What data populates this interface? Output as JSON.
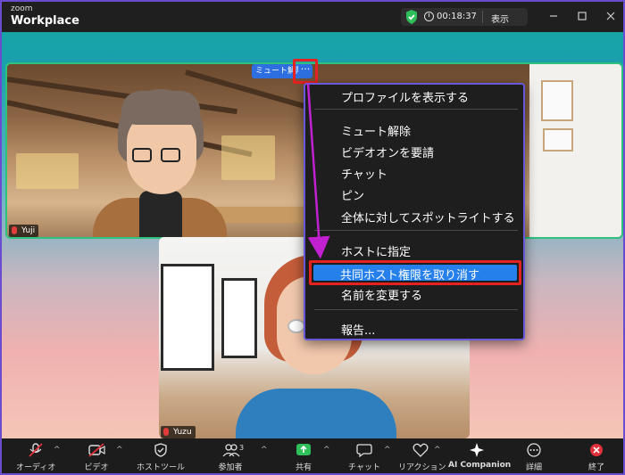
{
  "app": {
    "brand_small": "zoom",
    "brand_large": "Workplace"
  },
  "status": {
    "timer": "00:18:37",
    "view_label": "表示"
  },
  "participants": {
    "yuji": {
      "name": "Yuji",
      "unmute_chip": "ミュート解除",
      "more_glyph": "···"
    },
    "yuzu": {
      "name": "Yuzu"
    }
  },
  "context_menu": {
    "items": [
      "プロファイルを表示する",
      "ミュート解除",
      "ビデオオンを要請",
      "チャット",
      "ピン",
      "全体に対してスポットライトする",
      "ホストに指定",
      "共同ホスト権限を取り消す",
      "名前を変更する",
      "報告..."
    ]
  },
  "toolbar": {
    "audio": "オーディオ",
    "video": "ビデオ",
    "host_tools": "ホストツール",
    "participants": "参加者",
    "participants_count": "3",
    "share": "共有",
    "chat": "チャット",
    "reactions": "リアクション",
    "ai_companion": "AI Companion",
    "more": "詳細",
    "end": "終了",
    "caret": "^"
  },
  "colors": {
    "accent_blue": "#2680eb",
    "highlight_red": "#e52222",
    "active_speaker_green": "#2ec27e",
    "arrow_magenta": "#c020d0",
    "share_green": "#2fbf5a",
    "end_red": "#e0313a"
  }
}
